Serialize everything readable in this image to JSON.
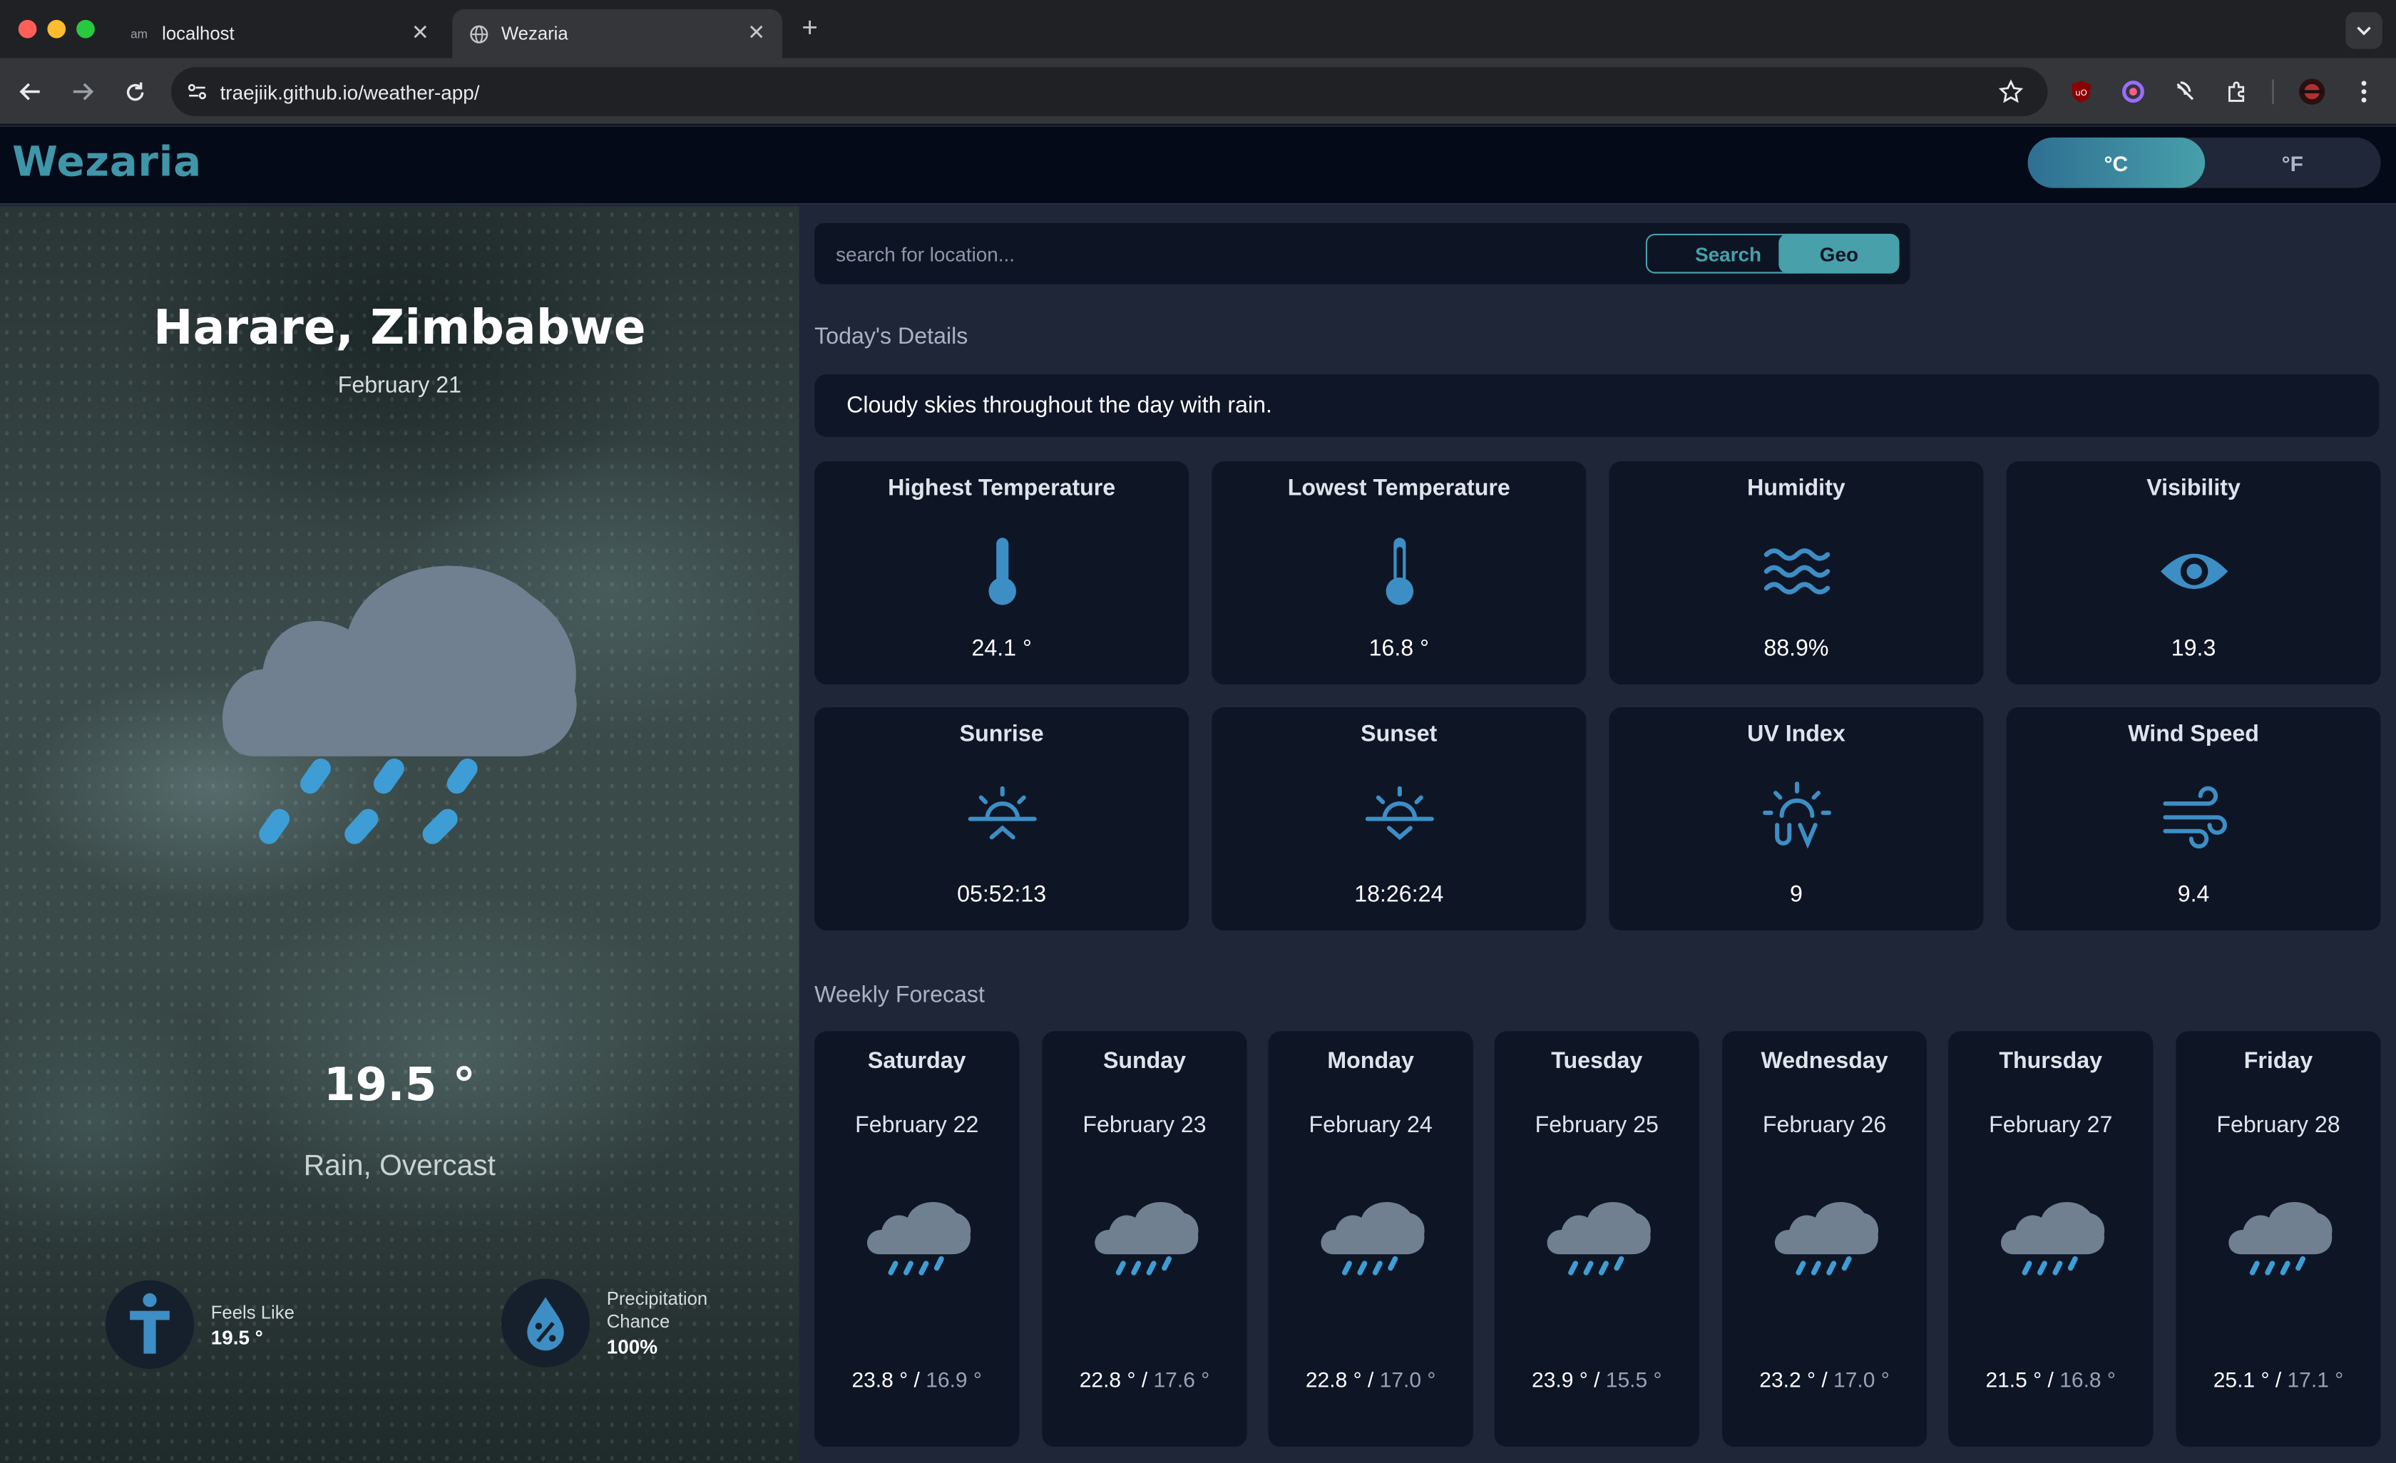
{
  "browser": {
    "tabs": [
      {
        "title": "localhost",
        "favicon": "am"
      },
      {
        "title": "Wezaria",
        "favicon": "globe-icon"
      }
    ],
    "new_tab": "+",
    "url": "traejiik.github.io/weather-app/",
    "window_dots": [
      "#ff5f57",
      "#febc2e",
      "#28c840"
    ]
  },
  "app": {
    "name": "Wezaria",
    "units": {
      "celsius": "°C",
      "fahrenheit": "°F",
      "active": "celsius"
    }
  },
  "hero": {
    "location": "Harare, Zimbabwe",
    "date": "February 21",
    "temp": "19.5 °",
    "condition": "Rain, Overcast",
    "feels_like": {
      "label": "Feels Like",
      "value": "19.5 °"
    },
    "precip": {
      "label_line1": "Precipitation",
      "label_line2": "Chance",
      "value": "100%"
    }
  },
  "search": {
    "placeholder": "search for location...",
    "search_label": "Search",
    "geo_label": "Geo"
  },
  "today": {
    "heading": "Today's Details",
    "summary": "Cloudy skies throughout the day with rain.",
    "cards": [
      {
        "title": "Highest Temperature",
        "icon": "thermometer-icon",
        "value": "24.1 °"
      },
      {
        "title": "Lowest Temperature",
        "icon": "thermometer-icon",
        "value": "16.8 °"
      },
      {
        "title": "Humidity",
        "icon": "humidity-waves-icon",
        "value": "88.9%"
      },
      {
        "title": "Visibility",
        "icon": "eye-icon",
        "value": "19.3"
      },
      {
        "title": "Sunrise",
        "icon": "sunrise-icon",
        "value": "05:52:13"
      },
      {
        "title": "Sunset",
        "icon": "sunset-icon",
        "value": "18:26:24"
      },
      {
        "title": "UV Index",
        "icon": "uv-index-icon",
        "value": "9"
      },
      {
        "title": "Wind Speed",
        "icon": "wind-icon",
        "value": "9.4"
      }
    ]
  },
  "weekly": {
    "heading": "Weekly Forecast",
    "days": [
      {
        "name": "Saturday",
        "date": "February 22",
        "high": "23.8 °",
        "low": "16.9 °"
      },
      {
        "name": "Sunday",
        "date": "February 23",
        "high": "22.8 °",
        "low": "17.6 °"
      },
      {
        "name": "Monday",
        "date": "February 24",
        "high": "22.8 °",
        "low": "17.0 °"
      },
      {
        "name": "Tuesday",
        "date": "February 25",
        "high": "23.9 °",
        "low": "15.5 °"
      },
      {
        "name": "Wednesday",
        "date": "February 26",
        "high": "23.2 °",
        "low": "17.0 °"
      },
      {
        "name": "Thursday",
        "date": "February 27",
        "high": "21.5 °",
        "low": "16.8 °"
      },
      {
        "name": "Friday",
        "date": "February 28",
        "high": "25.1 °",
        "low": "17.1 °"
      }
    ]
  },
  "colors": {
    "accent": "#47a0aa",
    "icon_blue": "#3d8ec4",
    "cloud": "#708090",
    "card_bg": "#0e1525",
    "page_bg": "#1e2638"
  }
}
